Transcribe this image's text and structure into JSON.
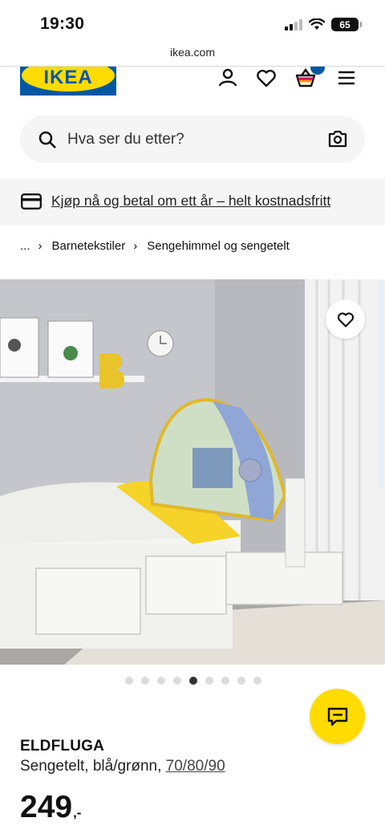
{
  "status": {
    "time": "19:30",
    "battery": "65"
  },
  "browser": {
    "url": "ikea.com"
  },
  "brand": {
    "name": "IKEA",
    "blue": "#0058a3",
    "yellow": "#ffdb00"
  },
  "header": {
    "icons": [
      "profile-icon",
      "heart-icon",
      "basket-icon",
      "hamburger-menu-icon"
    ]
  },
  "search": {
    "placeholder": "Hva ser du etter?"
  },
  "promo": {
    "text": "Kjøp nå og betal om ett år – helt kostnadsfritt"
  },
  "breadcrumb": {
    "ellipsis": "...",
    "items": [
      "Barnetekstiler",
      "Sengehimmel og sengetelt"
    ]
  },
  "gallery": {
    "count": 9,
    "active_index": 4
  },
  "product": {
    "name": "ELDFLUGA",
    "description": "Sengetelt, blå/grønn, ",
    "size": "70/80/90",
    "price": "249",
    "price_suffix": ",-"
  }
}
